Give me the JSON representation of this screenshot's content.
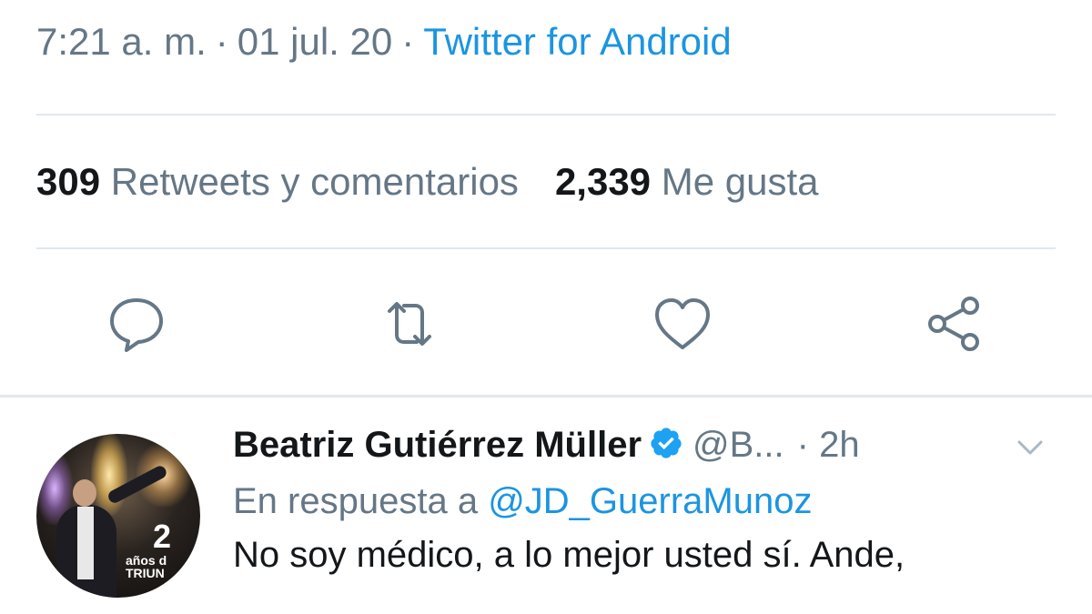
{
  "tweet_meta": {
    "time": "7:21 a. m.",
    "separator": "·",
    "date": "01 jul. 20",
    "source": "Twitter for Android"
  },
  "stats": {
    "retweets_count": "309",
    "retweets_label": "Retweets y comentarios",
    "likes_count": "2,339",
    "likes_label": "Me gusta"
  },
  "actions": [
    {
      "name": "reply",
      "icon": "reply-icon"
    },
    {
      "name": "retweet",
      "icon": "retweet-icon"
    },
    {
      "name": "like",
      "icon": "heart-icon"
    },
    {
      "name": "share",
      "icon": "share-icon"
    }
  ],
  "reply": {
    "name": "Beatriz Gutiérrez Müller",
    "handle": "@B...",
    "time": "· 2h",
    "in_reply_prefix": "En respuesta a",
    "in_reply_mention": "@JD_GuerraMunoz",
    "text": "No soy médico, a lo mejor usted sí. Ande,",
    "avatar_badge_number": "2",
    "avatar_badge_text": "años d\nTRIUN"
  },
  "colors": {
    "link_blue": "#1b95e0",
    "muted_gray": "#657786",
    "text_dark": "#14171a",
    "divider": "#e1e8ed",
    "verified_blue": "#1da1f2"
  }
}
